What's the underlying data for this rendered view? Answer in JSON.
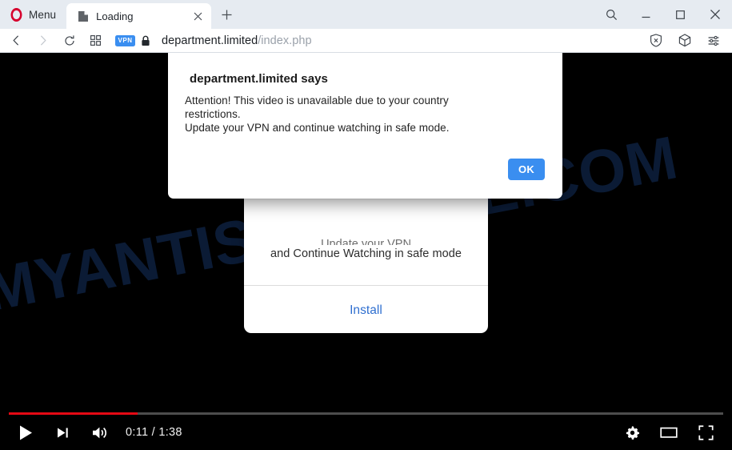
{
  "browser": {
    "menu_label": "Menu",
    "logo_name": "opera-logo",
    "tab": {
      "title": "Loading",
      "favicon_name": "page-favicon",
      "close_name": "close-icon"
    },
    "new_tab_label": "+",
    "window_controls": {
      "search": "search-icon",
      "minimize": "minimize-icon",
      "maximize": "maximize-icon",
      "close": "close-icon"
    },
    "toolbar": {
      "back": "back-arrow-icon",
      "forward": "forward-arrow-icon",
      "reload": "reload-icon",
      "tab_grid": "tab-grid-icon",
      "vpn_badge": "VPN",
      "lock": "lock-icon",
      "url_domain": "department.limited",
      "url_path": "/index.php",
      "url_full": "department.limited/index.php",
      "shield": "shield-blocker-icon",
      "wallet": "crypto-wallet-icon",
      "easy_setup": "easy-setup-sliders-icon"
    }
  },
  "dialog": {
    "title": "department.limited says",
    "line1": "Attention! This video is unavailable due to your country",
    "line2": "restrictions.",
    "line3": "Update your VPN and continue watching in safe mode.",
    "ok_label": "OK",
    "accent_color": "#3a8ef0"
  },
  "site_card": {
    "clipped_text": "Update your VPN",
    "message": "and Continue Watching in safe mode",
    "install_label": "Install",
    "link_color": "#2f6fd0"
  },
  "watermark": {
    "text": "MYANTISPYWARE.COM",
    "color": "#132c56"
  },
  "player": {
    "progress_percent": 18,
    "progress_color": "#e50914",
    "current_time": "0:11",
    "duration": "1:38",
    "timecode": "0:11 / 1:38",
    "play_icon": "play-icon",
    "next_icon": "next-track-icon",
    "volume_icon": "volume-icon",
    "settings_icon": "settings-gear-icon",
    "theater_icon": "theater-mode-icon",
    "fullscreen_icon": "fullscreen-icon"
  }
}
